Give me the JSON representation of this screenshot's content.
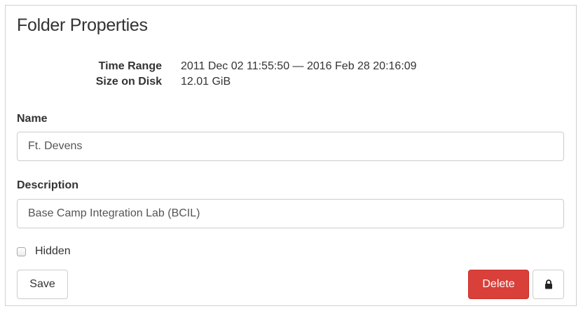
{
  "panel": {
    "title": "Folder Properties"
  },
  "meta": {
    "time_range_label": "Time Range",
    "time_range_value": "2011 Dec 02 11:55:50 — 2016 Feb 28 20:16:09",
    "size_label": "Size on Disk",
    "size_value": "12.01 GiB"
  },
  "form": {
    "name_label": "Name",
    "name_value": "Ft. Devens",
    "description_label": "Description",
    "description_value": "Base Camp Integration Lab (BCIL)",
    "hidden_label": "Hidden",
    "hidden_checked": false
  },
  "actions": {
    "save_label": "Save",
    "delete_label": "Delete",
    "lock_icon": "lock-icon"
  },
  "colors": {
    "danger": "#d9403a",
    "border": "#cccccc",
    "text": "#333333"
  }
}
